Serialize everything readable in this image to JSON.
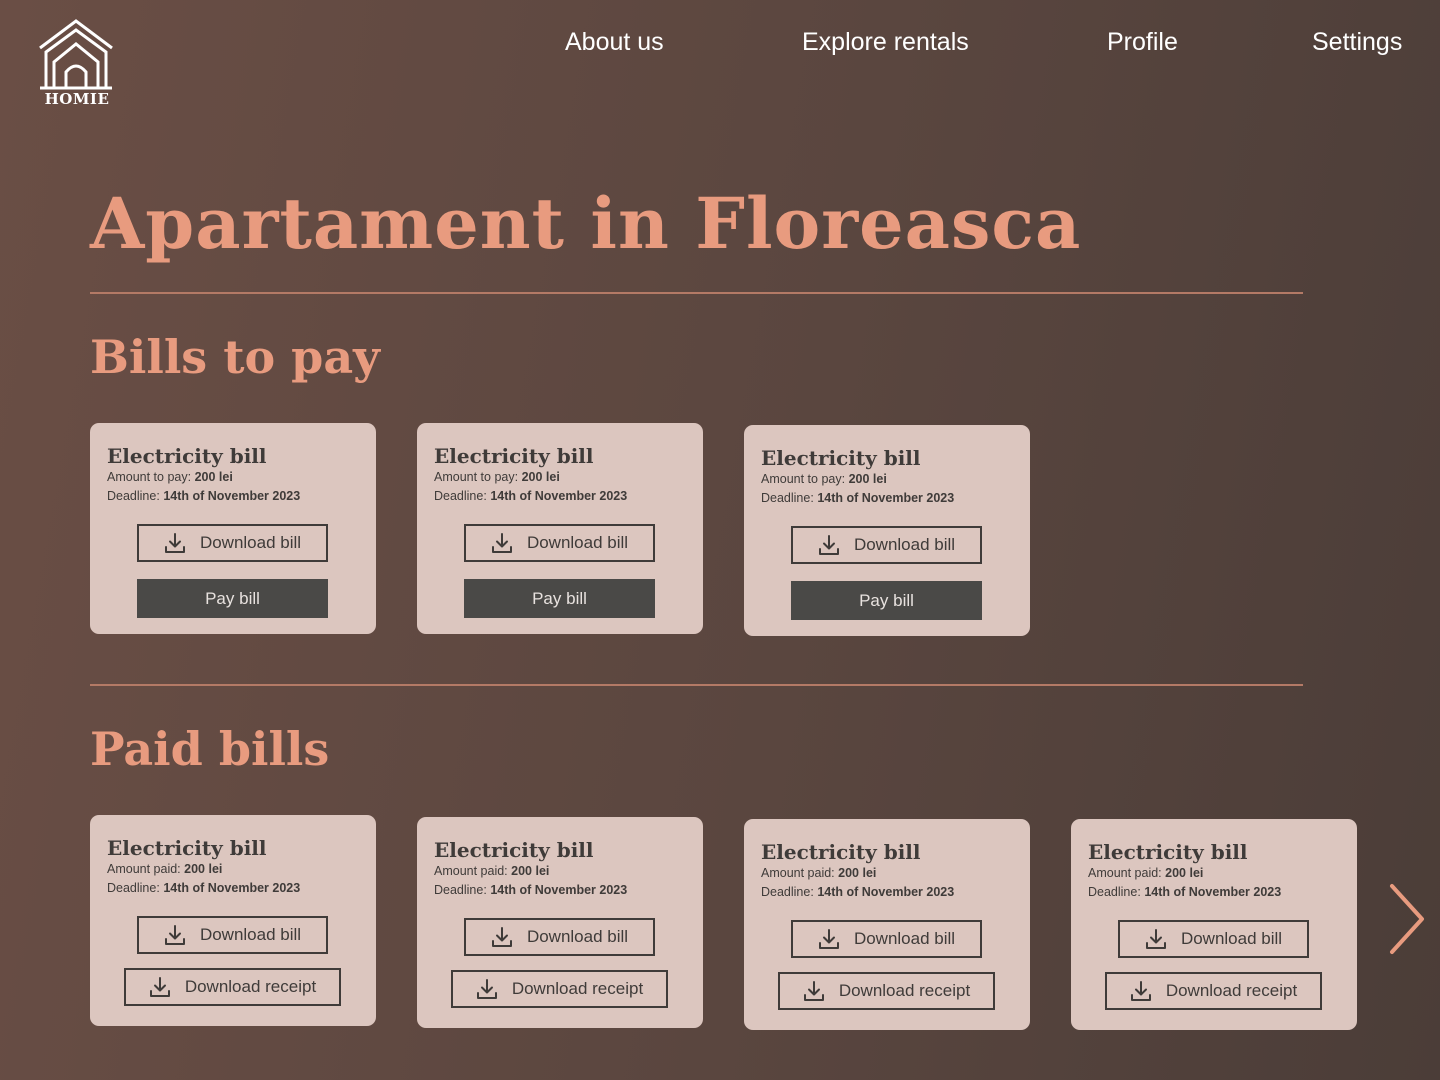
{
  "logo": {
    "text": "HOMIE",
    "icon": "house-logo-icon"
  },
  "nav": [
    {
      "label": "About us"
    },
    {
      "label": "Explore rentals"
    },
    {
      "label": "Profile"
    },
    {
      "label": "Settings"
    }
  ],
  "page_title": "Apartament in Floreasca",
  "bills_to_pay": {
    "title": "Bills to pay",
    "cards": [
      {
        "title": "Electricity bill",
        "amount_label": "Amount to pay:",
        "amount": "200 lei",
        "deadline_label": "Deadline:",
        "deadline": "14th of November 2023",
        "download_label": "Download bill",
        "pay_label": "Pay bill"
      },
      {
        "title": "Electricity bill",
        "amount_label": "Amount to pay:",
        "amount": "200 lei",
        "deadline_label": "Deadline:",
        "deadline": "14th of November 2023",
        "download_label": "Download bill",
        "pay_label": "Pay bill"
      },
      {
        "title": "Electricity bill",
        "amount_label": "Amount to pay:",
        "amount": "200 lei",
        "deadline_label": "Deadline:",
        "deadline": "14th of November 2023",
        "download_label": "Download bill",
        "pay_label": "Pay bill"
      }
    ]
  },
  "paid_bills": {
    "title": "Paid bills",
    "cards": [
      {
        "title": "Electricity bill",
        "amount_label": "Amount paid:",
        "amount": "200 lei",
        "deadline_label": "Deadline:",
        "deadline": "14th of November 2023",
        "download_label": "Download bill",
        "receipt_label": "Download receipt"
      },
      {
        "title": "Electricity bill",
        "amount_label": "Amount paid:",
        "amount": "200 lei",
        "deadline_label": "Deadline:",
        "deadline": "14th of November 2023",
        "download_label": "Download bill",
        "receipt_label": "Download receipt"
      },
      {
        "title": "Electricity bill",
        "amount_label": "Amount paid:",
        "amount": "200 lei",
        "deadline_label": "Deadline:",
        "deadline": "14th of November 2023",
        "download_label": "Download bill",
        "receipt_label": "Download receipt"
      },
      {
        "title": "Electricity bill",
        "amount_label": "Amount paid:",
        "amount": "200 lei",
        "deadline_label": "Deadline:",
        "deadline": "14th of November 2023",
        "download_label": "Download bill",
        "receipt_label": "Download receipt"
      }
    ]
  },
  "icons": {
    "download": "download-icon",
    "next": "chevron-right-icon"
  },
  "colors": {
    "accent": "#e89b7f",
    "card_background": "#dcc6bf",
    "text_dark": "#3f3b39",
    "button_dark": "#4a4947",
    "background_start": "#6a4e45",
    "background_end": "#4b3d38"
  }
}
